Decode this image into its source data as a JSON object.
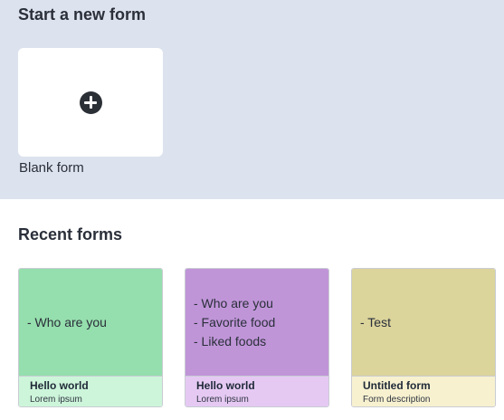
{
  "start_section": {
    "title": "Start a new form",
    "blank_form": {
      "label": "Blank form",
      "icon": "plus-circle-icon"
    }
  },
  "recent_section": {
    "title": "Recent forms",
    "forms": [
      {
        "preview_lines": [
          "- Who are you"
        ],
        "title": "Hello world",
        "description": "Lorem ipsum",
        "preview_color": "#95dead",
        "footer_color": "#cdf5da"
      },
      {
        "preview_lines": [
          "- Who are you",
          "- Favorite food",
          "- Liked foods"
        ],
        "title": "Hello world",
        "description": "Lorem ipsum",
        "preview_color": "#c095d8",
        "footer_color": "#e5c9f3"
      },
      {
        "preview_lines": [
          "- Test"
        ],
        "title": "Untitled form",
        "description": "Form description",
        "preview_color": "#dbd49b",
        "footer_color": "#f7f1d0"
      }
    ]
  }
}
